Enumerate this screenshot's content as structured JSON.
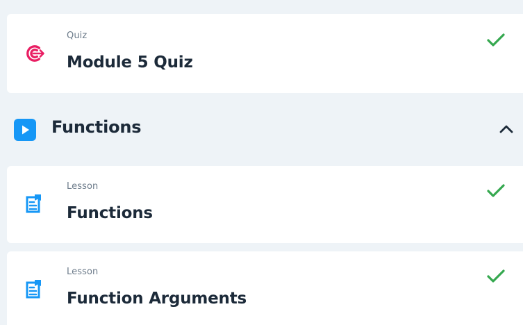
{
  "quiz_card": {
    "kind": "Quiz",
    "title": "Module 5 Quiz",
    "icon": "target-icon",
    "status_icon": "check-icon",
    "accent_color": "#e91e63",
    "status_color": "#35a84f"
  },
  "section": {
    "title": "Functions",
    "icon": "play-icon",
    "toggle_icon": "chevron-up-icon",
    "accent_color": "#1697f6"
  },
  "lessons": [
    {
      "kind": "Lesson",
      "title": "Functions",
      "icon": "document-icon",
      "status_icon": "check-icon"
    },
    {
      "kind": "Lesson",
      "title": "Function Arguments",
      "icon": "document-icon",
      "status_icon": "check-icon"
    }
  ]
}
